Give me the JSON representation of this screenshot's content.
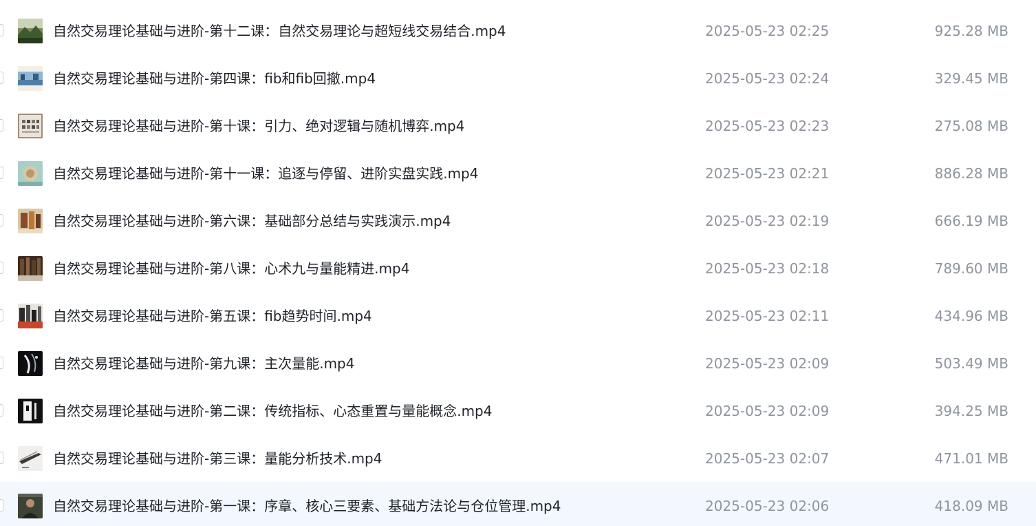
{
  "files": [
    {
      "name": "自然交易理论基础与进阶-第十二课：自然交易理论与超短线交易结合.mp4",
      "date": "2025-05-23 02:25",
      "size": "925.28 MB",
      "thumb": "thumbnail-landscape-icon"
    },
    {
      "name": "自然交易理论基础与进阶-第四课：fib和fib回撤.mp4",
      "date": "2025-05-23 02:24",
      "size": "329.45 MB",
      "thumb": "thumbnail-beach-icon"
    },
    {
      "name": "自然交易理论基础与进阶-第十课：引力、绝对逻辑与随机博弈.mp4",
      "date": "2025-05-23 02:23",
      "size": "275.08 MB",
      "thumb": "thumbnail-grid-icon"
    },
    {
      "name": "自然交易理论基础与进阶-第十一课：追逐与停留、进阶实盘实践.mp4",
      "date": "2025-05-23 02:21",
      "size": "886.28 MB",
      "thumb": "thumbnail-teal-icon"
    },
    {
      "name": "自然交易理论基础与进阶-第六课：基础部分总结与实践演示.mp4",
      "date": "2025-05-23 02:19",
      "size": "666.19 MB",
      "thumb": "thumbnail-warm-icon"
    },
    {
      "name": "自然交易理论基础与进阶-第八课：心术九与量能精进.mp4",
      "date": "2025-05-23 02:18",
      "size": "789.60 MB",
      "thumb": "thumbnail-dark-brown-icon"
    },
    {
      "name": "自然交易理论基础与进阶-第五课：fib趋势时间.mp4",
      "date": "2025-05-23 02:11",
      "size": "434.96 MB",
      "thumb": "thumbnail-city-icon"
    },
    {
      "name": "自然交易理论基础与进阶-第九课：主次量能.mp4",
      "date": "2025-05-23 02:09",
      "size": "503.49 MB",
      "thumb": "thumbnail-night-icon"
    },
    {
      "name": "自然交易理论基础与进阶-第二课：传统指标、心态重置与量能概念.mp4",
      "date": "2025-05-23 02:09",
      "size": "394.25 MB",
      "thumb": "thumbnail-bw-icon"
    },
    {
      "name": "自然交易理论基础与进阶-第三课：量能分析技术.mp4",
      "date": "2025-05-23 02:07",
      "size": "471.01 MB",
      "thumb": "thumbnail-bridge-icon"
    },
    {
      "name": "自然交易理论基础与进阶-第一课：序章、核心三要素、基础方法论与仓位管理.mp4",
      "date": "2025-05-23 02:06",
      "size": "418.09 MB",
      "thumb": "thumbnail-portrait-icon"
    }
  ],
  "colors": {
    "name_text": "#1f2329",
    "meta_text": "#8f959e",
    "hover_row": "#f2f8fe"
  }
}
